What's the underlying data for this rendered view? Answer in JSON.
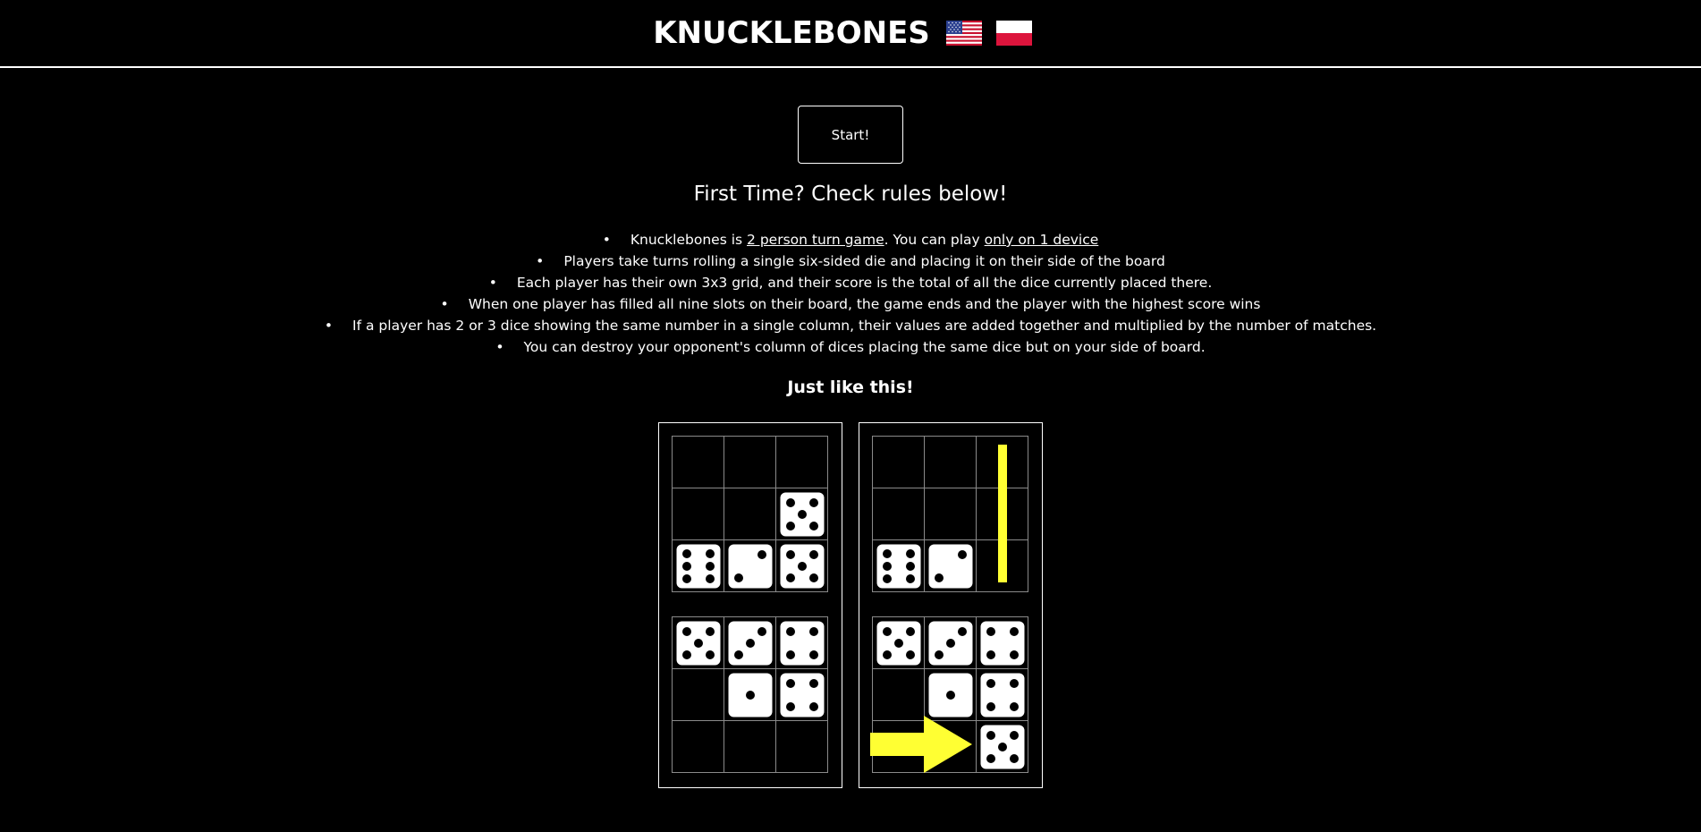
{
  "header": {
    "title": "KNUCKLEBONES"
  },
  "languages": [
    {
      "code": "en-US",
      "flag": "us-flag"
    },
    {
      "code": "pl",
      "flag": "pl-flag"
    }
  ],
  "start_button": "Start!",
  "rules_heading": "First Time? Check rules below!",
  "rules": [
    {
      "before": "Knucklebones is ",
      "link1": "2 person turn game",
      "middle": ". You can play ",
      "link2": "only on 1 device"
    },
    {
      "text": "Players take turns rolling a single six-sided die and placing it on their side of the board"
    },
    {
      "text": "Each player has their own 3x3 grid, and their score is the total of all the dice currently placed there."
    },
    {
      "text": "When one player has filled all nine slots on their board, the game ends and the player with the highest score wins"
    },
    {
      "text": "If a player has 2 or 3 dice showing the same number in a single column, their values are added together and multiplied by the number of matches."
    },
    {
      "text": "You can destroy your opponent's column of dices placing the same dice but on your side of board."
    }
  ],
  "example_heading": "Just like this!",
  "colors": {
    "background": "#000000",
    "foreground": "#ffffff",
    "highlight": "#ffff33"
  },
  "example_boards": [
    {
      "top": [
        [
          0,
          0,
          0
        ],
        [
          0,
          0,
          5
        ],
        [
          6,
          2,
          5
        ]
      ],
      "bottom": [
        [
          5,
          3,
          4
        ],
        [
          0,
          1,
          4
        ],
        [
          0,
          0,
          0
        ]
      ]
    },
    {
      "top": [
        [
          0,
          0,
          0
        ],
        [
          0,
          0,
          0
        ],
        [
          6,
          2,
          0
        ]
      ],
      "bottom": [
        [
          5,
          3,
          4
        ],
        [
          0,
          1,
          4
        ],
        [
          0,
          0,
          5
        ]
      ],
      "annotations": [
        "yellow-vertical-bar-column-3",
        "yellow-arrow-pointing-right-at-placed-die"
      ]
    }
  ]
}
